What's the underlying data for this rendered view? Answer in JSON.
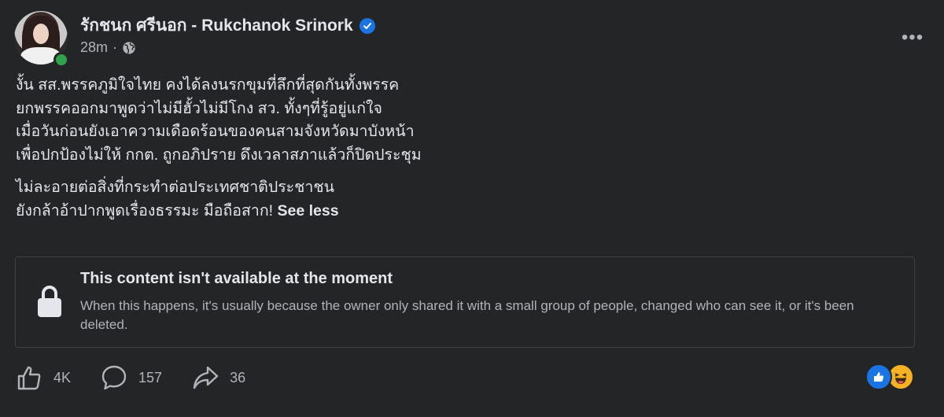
{
  "post": {
    "author_name": "รักชนก ศรีนอก - Rukchanok Srinork",
    "timestamp": "28m",
    "separator": "·",
    "more_label": "•••",
    "body_lines": [
      "งั้น สส.พรรคภูมิใจไทย คงได้ลงนรกขุมที่ลึกที่สุดกันทั้งพรรค",
      "ยกพรรคออกมาพูดว่าไม่มีฮั้วไม่มีโกง สว. ทั้งๆที่รู้อยู่แก่ใจ",
      "เมื่อวันก่อนยังเอาความเดือดร้อนของคนสามจังหวัดมาบังหน้า",
      "เพื่อปกป้องไม่ให้ กกต. ถูกอภิปราย ดึงเวลาสภาแล้วก็ปิดประชุม"
    ],
    "body_lines_2": [
      "ไม่ละอายต่อสิ่งที่กระทำต่อประเทศชาติประชาชน",
      "ยังกล้าอ้าปากพูดเรื่องธรรมะ มือถือสาก!"
    ],
    "see_less_label": "See less"
  },
  "unavailable": {
    "title": "This content isn't available at the moment",
    "description": "When this happens, it's usually because the owner only shared it with a small group of people, changed who can see it, or it's been deleted."
  },
  "actions": {
    "likes": "4K",
    "comments": "157",
    "shares": "36"
  },
  "reactions": [
    "like-icon",
    "haha-icon"
  ],
  "colors": {
    "background": "#242526",
    "text_primary": "#e4e6eb",
    "text_secondary": "#b0b3b8",
    "verified": "#1b74e4",
    "online": "#31a24c"
  }
}
